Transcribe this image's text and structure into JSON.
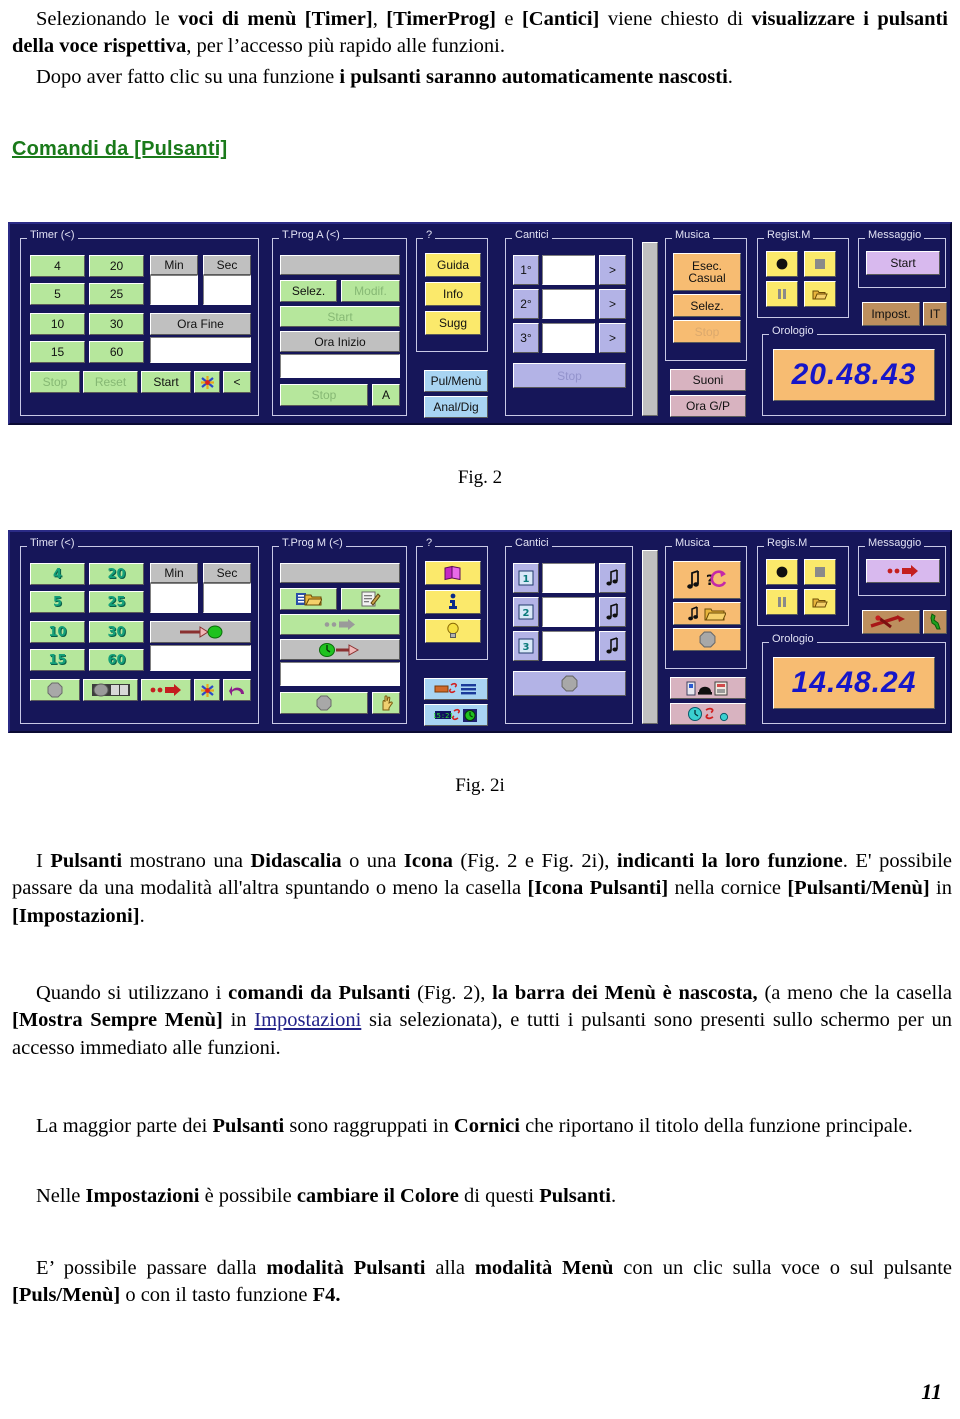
{
  "document": {
    "page_number": "11",
    "paragraphs": [
      {
        "id": "p1",
        "html": "Selezionando le <b>voci di men&ugrave; [Timer]</b>, <b>[TimerProg]</b> e <b>[Cantici]</b> viene chiesto di <b>visualizzare i pulsanti della voce rispettiva</b>, per l&rsquo;accesso pi&ugrave; rapido alle funzioni."
      },
      {
        "id": "p2",
        "html": "Dopo aver fatto clic su una funzione <b>i pulsanti saranno automaticamente nascosti</b>."
      },
      {
        "id": "p3",
        "html": "I <b>Pulsanti</b> mostrano una <b>Didascalia</b> o una <b>Icona</b> (Fig. 2 e Fig. 2i), <b>indicanti la loro funzione</b>. E' possibile passare da una modalit&agrave; all'altra spuntando o meno la casella <b>[Icona Pulsanti]</b> nella cornice <b>[Pulsanti/Men&ugrave;]</b> in <b>[Impostazioni]</b>."
      },
      {
        "id": "p4",
        "html": "Quando si utilizzano i <b>comandi da Pulsanti</b> (Fig. 2), <b>la barra dei Men&ugrave; &egrave; nascosta,</b> (a meno che la casella <b>[Mostra Sempre Men&ugrave;]</b> in <span class=\"lnk\">Impostazioni</span> sia selezionata), e tutti i pulsanti sono presenti sullo schermo per un accesso immediato alle funzioni."
      },
      {
        "id": "p5",
        "html": "La maggior parte dei <b>Pulsanti</b> sono raggruppati in <b>Cornici</b> che riportano il titolo della funzione principale."
      },
      {
        "id": "p6",
        "html": "Nelle <b>Impostazioni</b> &egrave; possibile <b>cambiare il Colore</b> di questi <b>Pulsanti</b>."
      },
      {
        "id": "p7",
        "html": "E&rsquo; possibile passare dalla <b>modalit&agrave; Pulsanti</b> alla <b>modalit&agrave; Men&ugrave;</b> con un clic sulla voce o sul pulsante <b>[Puls/Men&ugrave;]</b> o con il tasto funzione <b>F4.</b>"
      }
    ],
    "heading": "Comandi da [Pulsanti]",
    "figure_captions": {
      "fig2": "Fig. 2",
      "fig2i": "Fig. 2i"
    }
  },
  "colors": {
    "toolbar_bg": "#161659",
    "frame_line": "#c9c9e6",
    "green_button": "#b6e79c",
    "gray_button": "#c0c0c0",
    "yellow_button": "#fbe96b",
    "light_blue_button": "#a8d4f2",
    "lavender_button": "#b3b3e6",
    "plum_button": "#d8b9ee",
    "orange_button": "#f7bc72",
    "pink_button": "#d8b3c0",
    "tan_button": "#bd8f5e",
    "clock_text": "#1616c8",
    "heading_green": "#1a7a1a",
    "link_blue": "#222288"
  },
  "fig2": {
    "groups": {
      "timer": {
        "legend": "Timer (<)",
        "preset_buttons": [
          "4",
          "20",
          "5",
          "25",
          "10",
          "30",
          "15",
          "60"
        ],
        "min_label": "Min",
        "sec_label": "Sec",
        "min_value": "",
        "sec_value": "",
        "ora_fine_label": "Ora Fine",
        "ora_fine_value": "",
        "stop_label": "Stop",
        "reset_label": "Reset",
        "start_label": "Start",
        "cancel_icon": "cancel-star-icon",
        "back_label": "<"
      },
      "tprog": {
        "legend": "T.Prog A (<)",
        "display_value": "",
        "selez_label": "Selez.",
        "modif_label": "Modif.",
        "start_label": "Start",
        "ora_inizio_label": "Ora Inizio",
        "ora_inizio_value": "",
        "stop_label": "Stop",
        "a_label": "A"
      },
      "help": {
        "legend": "?",
        "guida_label": "Guida",
        "info_label": "Info",
        "sugg_label": "Sugg",
        "pulmenu_label": "Pul/Menù",
        "analdig_label": "Anal/Dig"
      },
      "cantici": {
        "legend": "Cantici",
        "rows": [
          {
            "num": "1°",
            "value": "",
            "go": ">"
          },
          {
            "num": "2°",
            "value": "",
            "go": ">"
          },
          {
            "num": "3°",
            "value": "",
            "go": ">"
          }
        ],
        "stop_label": "Stop"
      },
      "musica": {
        "legend": "Musica",
        "esec_casual_line1": "Esec.",
        "esec_casual_line2": "Casual",
        "selez_label": "Selez.",
        "stop_label": "Stop",
        "suoni_label": "Suoni",
        "ora_gp_label": "Ora G/P"
      },
      "regist": {
        "legend": "Regist.M",
        "record_icon": "record-dot-icon",
        "stop_icon": "stop-square-icon",
        "pause_icon": "pause-bars-icon",
        "open_icon": "open-folder-icon"
      },
      "messaggio": {
        "legend": "Messaggio",
        "start_label": "Start",
        "impost_label": "Impost.",
        "lang_label": "IT"
      },
      "orologio": {
        "legend": "Orologio",
        "time": "20.48.43"
      }
    }
  },
  "fig2i": {
    "groups": {
      "timer": {
        "legend": "Timer (<)",
        "preset_buttons": [
          "4",
          "20",
          "5",
          "25",
          "10",
          "30",
          "15",
          "60"
        ],
        "min_label": "Min",
        "sec_label": "Sec",
        "min_value": "",
        "sec_value": "",
        "ora_fine_icon": "arrow-to-green-clock-icon",
        "ora_fine_value": "",
        "stop_icon": "stop-sign-icon",
        "reset_icon": "counter-reset-icon",
        "start_icon": "red-arrow-icon",
        "cancel_icon": "cancel-star-icon",
        "back_icon": "purple-return-arrow-icon"
      },
      "tprog": {
        "legend": "T.Prog M (<)",
        "display_value": "",
        "selez_icon": "open-folder-list-icon",
        "modif_icon": "edit-pencil-icon",
        "start_icon": "red-arrow-icon",
        "ora_inizio_icon": "green-clock-arrow-icon",
        "ora_inizio_value": "",
        "stop_icon": "stop-sign-icon",
        "a_icon": "hand-icon"
      },
      "help": {
        "legend": "?",
        "guida_icon": "book-icon",
        "info_icon": "info-icon",
        "sugg_icon": "lightbulb-icon",
        "pulmenu_icon": "buttons-menu-swap-icon",
        "analdig_icon": "analog-digital-clock-icon"
      },
      "cantici": {
        "legend": "Cantici",
        "rows": [
          {
            "num": "1",
            "value": "",
            "go_icon": "music-note-icon"
          },
          {
            "num": "2",
            "value": "",
            "go_icon": "music-note-icon"
          },
          {
            "num": "3",
            "value": "",
            "go_icon": "music-note-icon"
          }
        ],
        "stop_icon": "stop-sign-icon"
      },
      "musica": {
        "legend": "Musica",
        "esec_casual_icon": "random-play-icon",
        "selez_icon": "note-folder-icon",
        "stop_icon": "stop-sign-icon",
        "suoni_icon": "sounds-devices-icon",
        "ora_gp_icon": "clock-swap-icon"
      },
      "regist": {
        "legend": "Regis.M",
        "record_icon": "record-dot-icon",
        "stop_icon": "stop-square-icon",
        "pause_icon": "pause-bars-icon",
        "open_icon": "open-folder-icon"
      },
      "messaggio": {
        "legend": "Messaggio",
        "start_icon": "red-arrow-icon",
        "impost_icon": "tools-wrench-icon",
        "lang_icon": "italy-map-icon"
      },
      "orologio": {
        "legend": "Orologio",
        "time": "14.48.24"
      }
    }
  }
}
